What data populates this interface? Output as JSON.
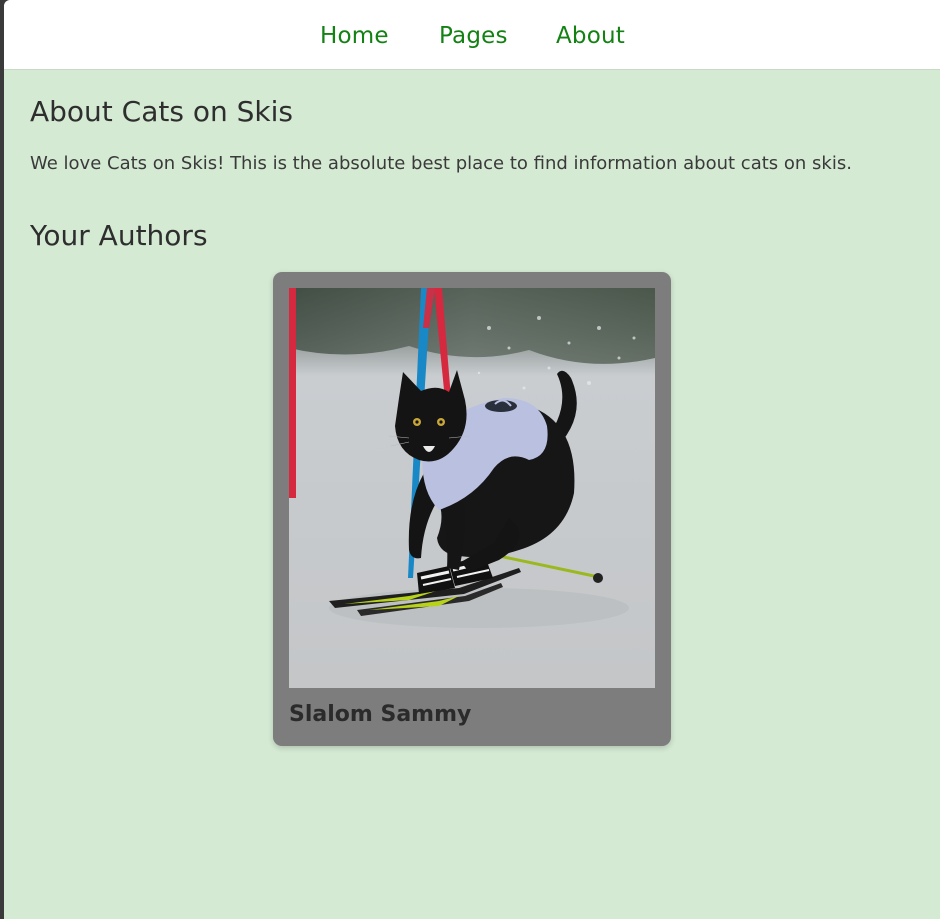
{
  "nav": {
    "home": "Home",
    "pages": "Pages",
    "about": "About",
    "link_color": "#138113"
  },
  "main": {
    "title": "About Cats on Skis",
    "intro": "We love Cats on Skis! This is the absolute best place to find information about cats on skis.",
    "authors_heading": "Your Authors",
    "background_color": "#d4ead3"
  },
  "authors": [
    {
      "name": "Slalom Sammy",
      "photo_icon": "black-cat-skiing-photo"
    }
  ]
}
